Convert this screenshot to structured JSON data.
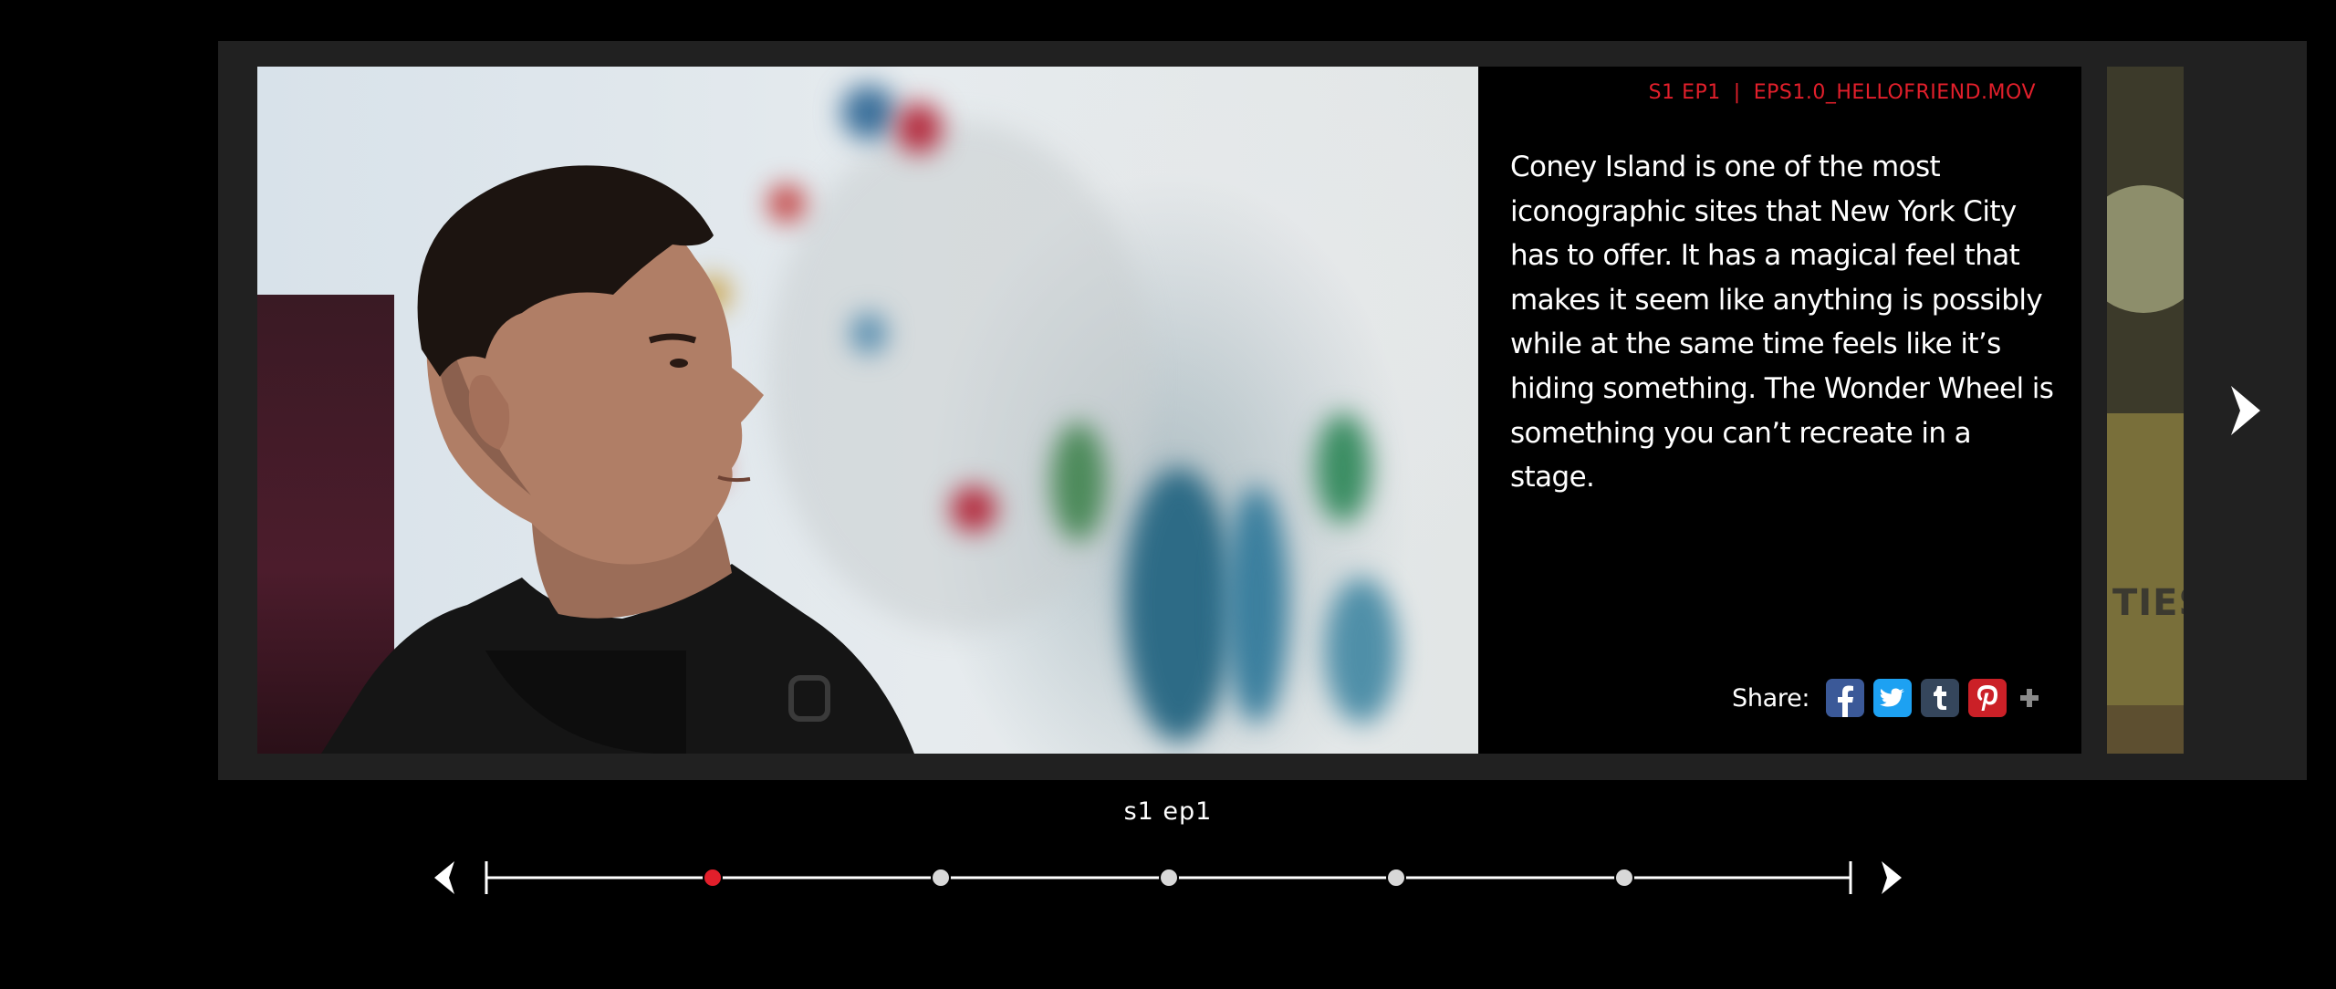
{
  "slide": {
    "episode_code": "S1 EP1",
    "separator": "|",
    "file_name": "EPS1.0_HELLOFRIEND.MOV",
    "description": "Coney Island is one of the most iconographic sites that New York City has to offer. It has a magical feel that makes it seem like anything is possibly while at the same time feels like it’s hiding something. The Wonder Wheel is something you can’t recreate in a stage.",
    "share_label": "Share:",
    "share_icons": [
      "facebook-icon",
      "twitter-icon",
      "tumblr-icon",
      "pinterest-icon",
      "plus-icon"
    ],
    "peek_text": "TIES"
  },
  "timeline": {
    "episode_label": "s1 ep1",
    "points": 6,
    "active_index": 0
  },
  "colors": {
    "accent_red": "#e21f2b",
    "facebook": "#3b5998",
    "twitter": "#1da1f2",
    "tumblr": "#35465c",
    "pinterest": "#cb2027",
    "stage": "#212121"
  }
}
